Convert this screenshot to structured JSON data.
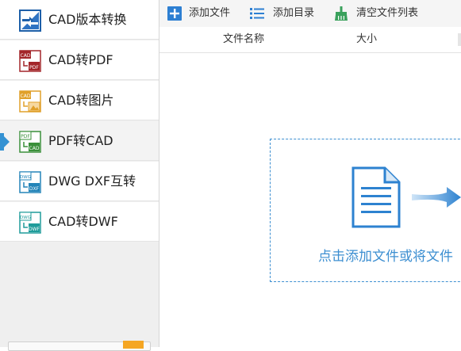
{
  "sidebar": {
    "items": [
      {
        "label": "CAD版本转换",
        "icon": "cad-version-convert-icon",
        "icon_text": ""
      },
      {
        "label": "CAD转PDF",
        "icon": "cad-to-pdf-icon",
        "icon_text": "CAD"
      },
      {
        "label": "CAD转图片",
        "icon": "cad-to-image-icon",
        "icon_text": "CAD"
      },
      {
        "label": "PDF转CAD",
        "icon": "pdf-to-cad-icon",
        "icon_text": "PDF"
      },
      {
        "label": "DWG DXF互转",
        "icon": "dwg-dxf-convert-icon",
        "icon_text": "DWG"
      },
      {
        "label": "CAD转DWF",
        "icon": "cad-to-dwf-icon",
        "icon_text": "DWG"
      }
    ],
    "active_index": 3,
    "accent_color": "#3592d3"
  },
  "toolbar": {
    "add_file": "添加文件",
    "add_folder": "添加目录",
    "clear_list": "清空文件列表"
  },
  "table": {
    "columns": [
      "文件名称",
      "大小"
    ]
  },
  "dropzone": {
    "hint": "点击添加文件或将文件",
    "color": "#3d8fd1"
  }
}
